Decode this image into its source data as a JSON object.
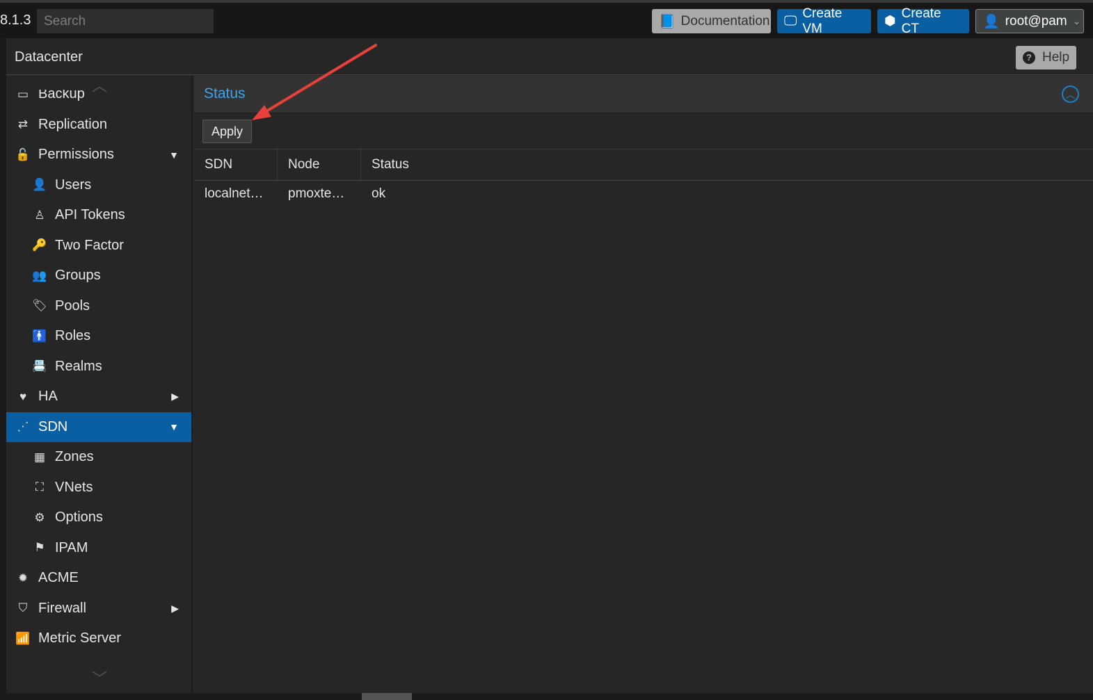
{
  "topbar": {
    "version": "8.1.3",
    "search_placeholder": "Search",
    "documentation": "Documentation",
    "create_vm": "Create VM",
    "create_ct": "Create CT",
    "user": "root@pam"
  },
  "header": {
    "title": "Datacenter",
    "help": "Help"
  },
  "sidebar": {
    "items": [
      {
        "label": "Backup",
        "icon": "floppy-icon"
      },
      {
        "label": "Replication",
        "icon": "retweet-icon"
      },
      {
        "label": "Permissions",
        "icon": "unlock-icon",
        "caret": "down"
      },
      {
        "label": "Users",
        "icon": "user-icon",
        "sub": true
      },
      {
        "label": "API Tokens",
        "icon": "user-outline-icon",
        "sub": true
      },
      {
        "label": "Two Factor",
        "icon": "key-icon",
        "sub": true
      },
      {
        "label": "Groups",
        "icon": "users-icon",
        "sub": true
      },
      {
        "label": "Pools",
        "icon": "tags-icon",
        "sub": true
      },
      {
        "label": "Roles",
        "icon": "male-icon",
        "sub": true
      },
      {
        "label": "Realms",
        "icon": "address-book-icon",
        "sub": true
      },
      {
        "label": "HA",
        "icon": "heartbeat-icon",
        "caret": "right"
      },
      {
        "label": "SDN",
        "icon": "sdn-icon",
        "caret": "down",
        "selected": true
      },
      {
        "label": "Zones",
        "icon": "th-icon",
        "sub": true
      },
      {
        "label": "VNets",
        "icon": "sitemap-icon",
        "sub": true
      },
      {
        "label": "Options",
        "icon": "gear-icon",
        "sub": true
      },
      {
        "label": "IPAM",
        "icon": "signpost-icon",
        "sub": true
      },
      {
        "label": "ACME",
        "icon": "certificate-icon"
      },
      {
        "label": "Firewall",
        "icon": "shield-icon",
        "caret": "right"
      },
      {
        "label": "Metric Server",
        "icon": "bar-chart-icon"
      }
    ]
  },
  "status": {
    "title": "Status",
    "apply": "Apply",
    "columns": [
      "SDN",
      "Node",
      "Status"
    ],
    "rows": [
      [
        "localnet…",
        "pmoxte…",
        "ok"
      ]
    ]
  },
  "colors": {
    "accent": "#0a5fa3",
    "title": "#3ea4ee",
    "annotation_arrow": "#e8403a"
  }
}
